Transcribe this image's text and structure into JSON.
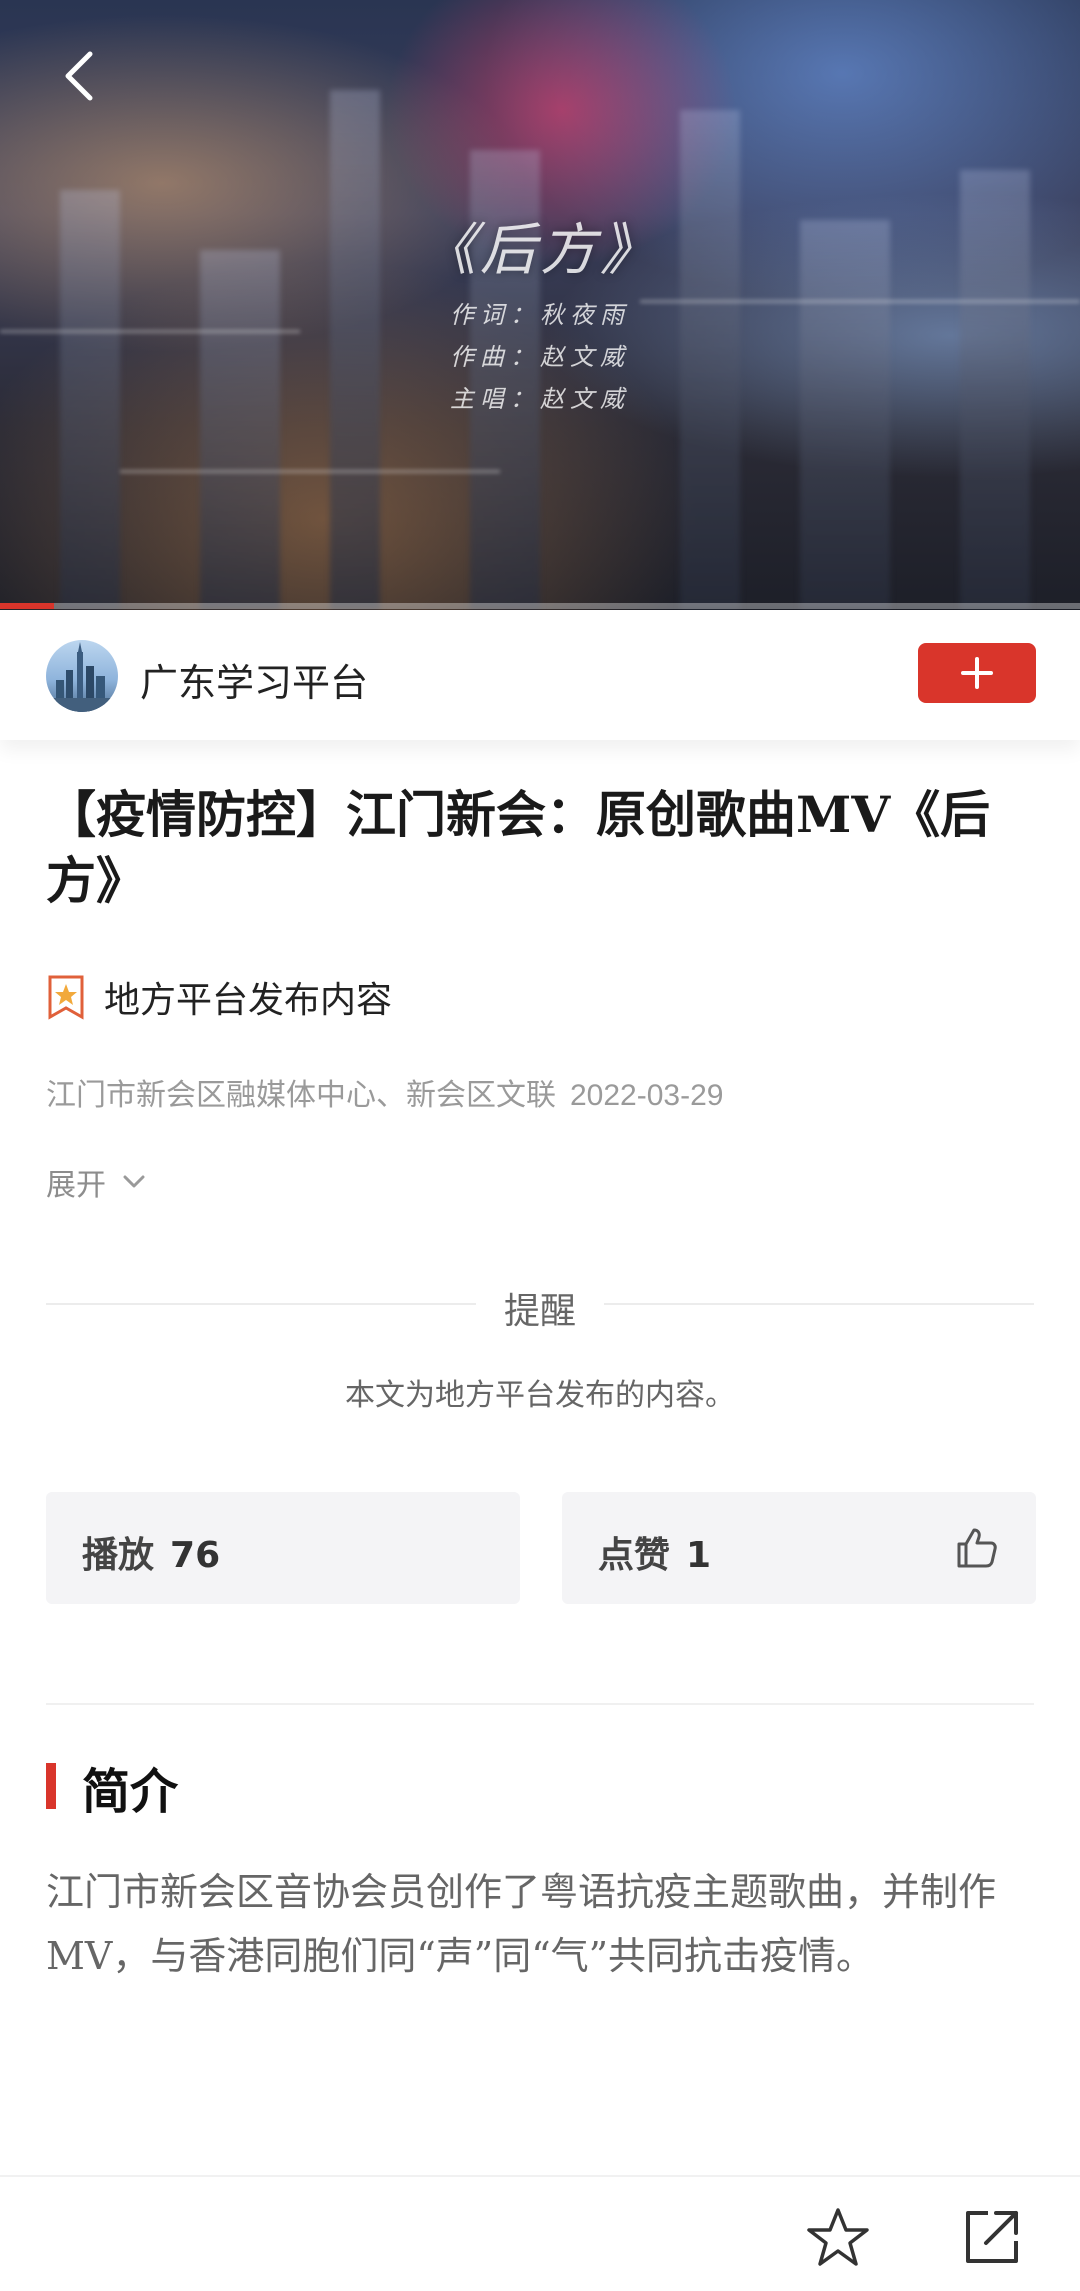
{
  "video": {
    "title": "《后方》",
    "credits": [
      "作词：秋夜雨",
      "作曲：赵文威",
      "主唱：赵文威"
    ],
    "progress_fraction": 0.05
  },
  "channel": {
    "name": "广东学习平台"
  },
  "article": {
    "title": "【疫情防控】江门新会：原创歌曲MV《后方》",
    "source_tag": "地方平台发布内容",
    "publisher": "江门市新会区融媒体中心、新会区文联",
    "date": "2022-03-29",
    "expand_label": "展开"
  },
  "reminder": {
    "title": "提醒",
    "text": "本文为地方平台发布的内容。"
  },
  "stats": {
    "play_label": "播放",
    "play_count": "76",
    "like_label": "点赞",
    "like_count": "1"
  },
  "intro": {
    "title": "简介",
    "text": "江门市新会区音协会员创作了粤语抗疫主题歌曲，并制作MV，与香港同胞们同“声”同“气”共同抗击疫情。"
  },
  "colors": {
    "accent": "#d9352b"
  }
}
